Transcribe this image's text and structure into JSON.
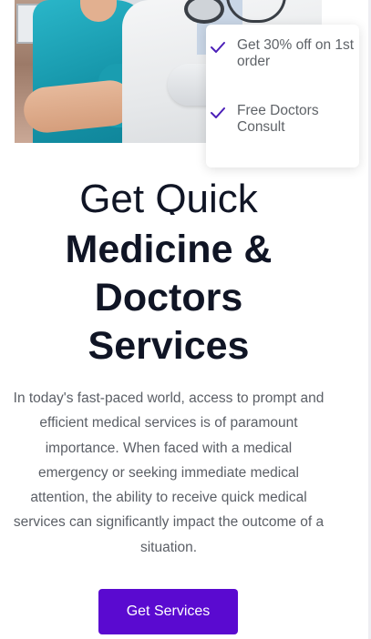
{
  "hero": {
    "image_alt": "nurse-and-doctor-photo"
  },
  "offers": {
    "check_color": "#4b1fb8",
    "items": [
      {
        "label": "Get 30% off on 1st order"
      },
      {
        "label": "Free Doctors Consult"
      }
    ]
  },
  "headline": {
    "line1": "Get Quick",
    "line2": "Medicine &",
    "line3": "Doctors",
    "line4": "Services"
  },
  "description": "In today's fast-paced world, access to prompt and efficient medical services is of paramount importance. When faced with a medical emergency or seeking immediate medical attention, the ability to receive quick medical services can significantly impact the outcome of a situation.",
  "cta": {
    "label": "Get Services",
    "color": "#5a0ad0"
  }
}
